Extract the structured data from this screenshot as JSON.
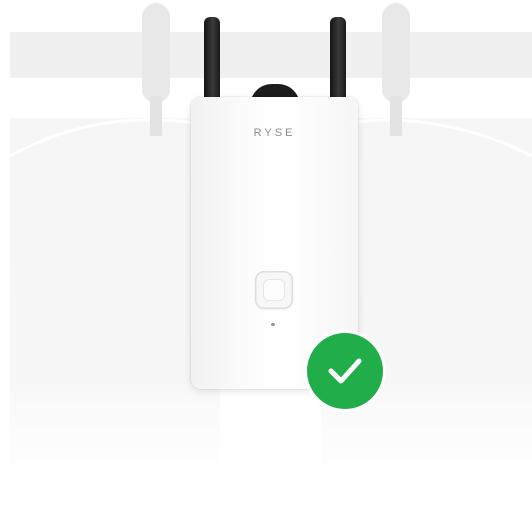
{
  "device": {
    "brand_label": "RYSE"
  },
  "status": {
    "icon": "checkmark-icon",
    "color": "#22ad4b"
  },
  "colors": {
    "antenna": "#1c1c1c",
    "device_body": "#fbfbfb",
    "curtain": "#f6f6f6"
  }
}
